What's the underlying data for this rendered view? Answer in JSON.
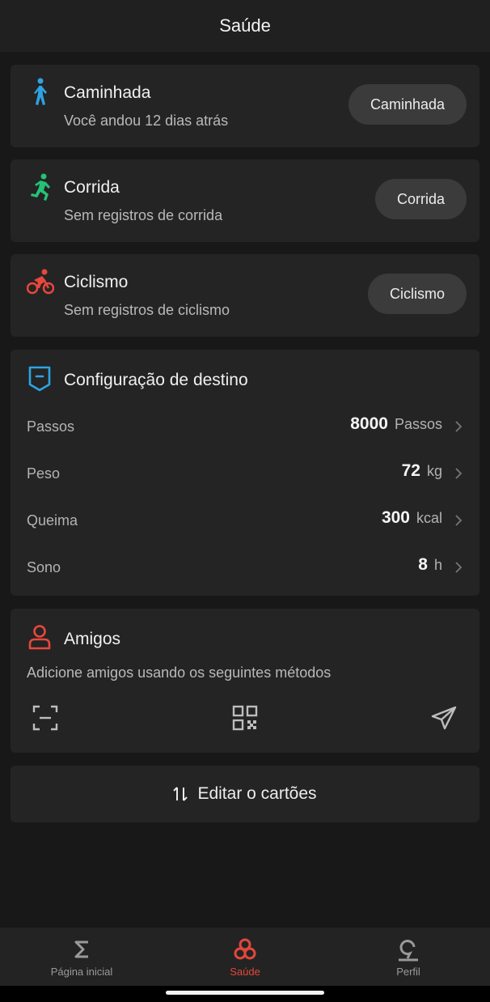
{
  "header": {
    "title": "Saúde"
  },
  "activities": [
    {
      "title": "Caminhada",
      "subtitle": "Você andou 12 dias atrás",
      "button": "Caminhada",
      "icon": "walking-icon",
      "color": "#2ea3e3"
    },
    {
      "title": "Corrida",
      "subtitle": "Sem registros de corrida",
      "button": "Corrida",
      "icon": "running-icon",
      "color": "#25c275"
    },
    {
      "title": "Ciclismo",
      "subtitle": "Sem registros de ciclismo",
      "button": "Ciclismo",
      "icon": "cycling-icon",
      "color": "#e8473d"
    }
  ],
  "goals": {
    "title": "Configuração de destino",
    "icon": "goal-flag-icon",
    "color": "#2ea3e3",
    "rows": [
      {
        "label": "Passos",
        "value": "8000",
        "unit": "Passos"
      },
      {
        "label": "Peso",
        "value": "72",
        "unit": "kg"
      },
      {
        "label": "Queima",
        "value": "300",
        "unit": "kcal"
      },
      {
        "label": "Sono",
        "value": "8",
        "unit": "h"
      }
    ]
  },
  "friends": {
    "title": "Amigos",
    "subtitle": "Adicione amigos usando os seguintes métodos",
    "icon": "person-icon",
    "color": "#e8473d",
    "methods": [
      "scan-icon",
      "qr-code-icon",
      "send-icon"
    ]
  },
  "edit_cards": {
    "label": "Editar o cartões",
    "icon": "sort-icon"
  },
  "bottom_nav": {
    "items": [
      {
        "label": "Página inicial",
        "icon": "sigma-icon"
      },
      {
        "label": "Saúde",
        "icon": "health-icon",
        "active": true
      },
      {
        "label": "Perfil",
        "icon": "profile-icon"
      }
    ],
    "active_color": "#e2473c"
  }
}
